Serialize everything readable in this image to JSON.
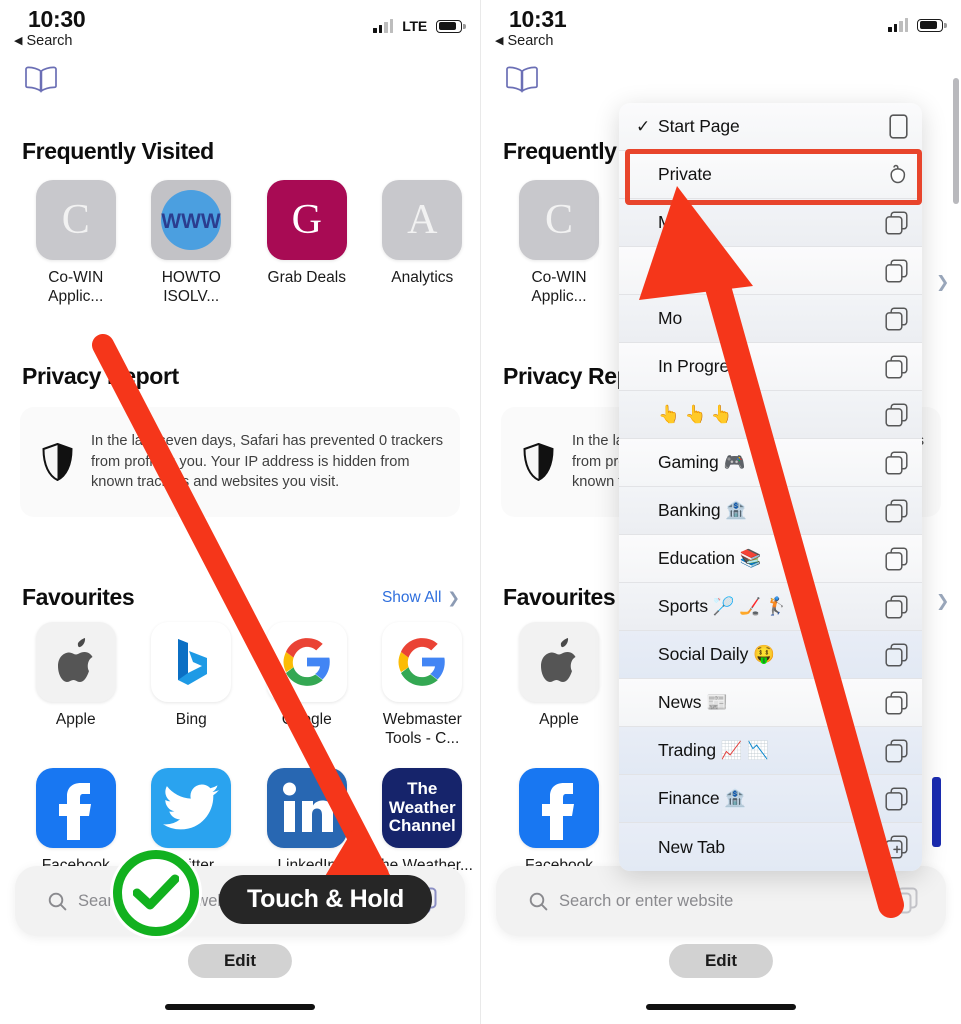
{
  "panels": [
    {
      "id": "left",
      "status": {
        "time": "10:30",
        "back_label": "Search",
        "carrier": "LTE",
        "signal_bars": 4,
        "battery_level": 72
      },
      "sections": {
        "frequently_visited": {
          "title": "Frequently Visited",
          "items": [
            {
              "name": "Co-WIN Applic...",
              "glyph": "C",
              "type": "letter",
              "bg": "#c8c8cc"
            },
            {
              "name": "HOWTO ISOLV...",
              "glyph": "WWW",
              "type": "www",
              "bg": "#c2c2c6"
            },
            {
              "name": "Grab Deals",
              "glyph": "G",
              "type": "letter",
              "bg": "#a80b54"
            },
            {
              "name": "Analytics",
              "glyph": "A",
              "type": "letter",
              "bg": "#c8c8cc"
            }
          ]
        },
        "privacy_report": {
          "title": "Privacy Report",
          "body": "In the last seven days, Safari has prevented 0 trackers from profiling you. Your IP address is hidden from known trackers and websites you visit."
        },
        "favourites": {
          "title": "Favourites",
          "show_all": "Show All",
          "items": [
            {
              "name": "Apple",
              "type": "apple",
              "bg": "#f2f2f2"
            },
            {
              "name": "Bing",
              "type": "bing",
              "bg": "#ffffff"
            },
            {
              "name": "Google",
              "type": "google",
              "bg": "#ffffff"
            },
            {
              "name": "Webmaster Tools - C...",
              "type": "google",
              "bg": "#ffffff"
            },
            {
              "name": "Facebook",
              "type": "facebook",
              "bg": "#1877f2"
            },
            {
              "name": "Twitter",
              "type": "twitter",
              "bg": "#2aa3ef"
            },
            {
              "name": "LinkedIn",
              "type": "linkedin",
              "bg": "#2867b2"
            },
            {
              "name": "The Weather...",
              "type": "weather",
              "bg": "#16246b"
            }
          ]
        }
      },
      "toolbar": {
        "search_placeholder": "Search or enter website",
        "edit_label": "Edit"
      },
      "callout": {
        "label": "Touch & Hold",
        "badge": "check-mark"
      }
    },
    {
      "id": "right",
      "status": {
        "time": "10:31",
        "back_label": "Search",
        "carrier": "",
        "signal_bars": 4,
        "battery_level": 72
      },
      "sections": {
        "frequently_visited": {
          "title": "Frequently Visited"
        },
        "privacy_report": {
          "title": "Privacy Report",
          "body": "In the last seven days, Safari has prevented 0 trackers from profiling you. Your IP address is hidden from known trackers and websites you visit."
        },
        "favourites": {
          "title": "Favourites",
          "items": [
            {
              "name": "Co-WIN Applic...",
              "glyph": "C",
              "type": "letter",
              "bg": "#c8c8cc"
            },
            {
              "name": "Apple",
              "type": "apple",
              "bg": "#f2f2f2"
            },
            {
              "name": "Facebook",
              "type": "facebook",
              "bg": "#1877f2"
            }
          ]
        }
      },
      "toolbar": {
        "search_placeholder": "Search or enter website",
        "edit_label": "Edit"
      }
    }
  ],
  "tab_group_menu": {
    "highlighted_item": "Private",
    "highlight_color": "#e8452c",
    "items": [
      {
        "label": "Start Page",
        "checked": true,
        "trailing_icon": "single-tab-icon"
      },
      {
        "label": "Private",
        "checked": false,
        "trailing_icon": "private-hand-icon"
      },
      {
        "label": "MF",
        "checked": false,
        "trailing_icon": "tabs-icon"
      },
      {
        "label": "Wes",
        "checked": false,
        "trailing_icon": "tabs-icon"
      },
      {
        "label": "Mo",
        "checked": false,
        "trailing_icon": "tabs-icon"
      },
      {
        "label": "In Progre",
        "checked": false,
        "trailing_icon": "tabs-icon"
      },
      {
        "label": "👆 👆 👆",
        "checked": false,
        "trailing_icon": "tabs-icon"
      },
      {
        "label": "Gaming 🎮",
        "checked": false,
        "trailing_icon": "tabs-icon"
      },
      {
        "label": "Banking 🏦",
        "checked": false,
        "trailing_icon": "tabs-icon"
      },
      {
        "label": "Education 📚",
        "checked": false,
        "trailing_icon": "tabs-icon"
      },
      {
        "label": "Sports 🏸 🏒 🏌",
        "checked": false,
        "trailing_icon": "tabs-icon"
      },
      {
        "label": "Social Daily 🤑",
        "checked": false,
        "trailing_icon": "tabs-icon"
      },
      {
        "label": "News 📰",
        "checked": false,
        "trailing_icon": "tabs-icon"
      },
      {
        "label": "Trading 📈 📉",
        "checked": false,
        "trailing_icon": "tabs-icon"
      },
      {
        "label": "Finance 🏦",
        "checked": false,
        "trailing_icon": "tabs-icon"
      },
      {
        "label": "New Tab",
        "checked": false,
        "trailing_icon": "new-tab-icon"
      }
    ]
  }
}
